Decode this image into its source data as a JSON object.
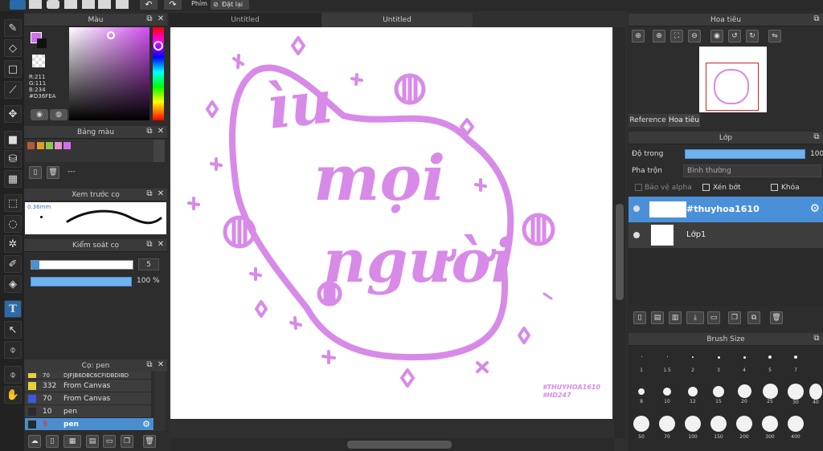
{
  "top_toolbar": {
    "items": [
      "Phím",
      "Đặt lại"
    ]
  },
  "tabs": [
    {
      "label": "Untitled"
    },
    {
      "label": "Untitled"
    }
  ],
  "color_panel": {
    "title": "Màu",
    "r": "R:211",
    "g": "G:111",
    "b": "B:234",
    "hex": "#D36FEA",
    "accent": "#d36fea"
  },
  "palette_panel": {
    "title": "Bảng màu",
    "dash": "---",
    "swatches": [
      "#b35a3a",
      "#e39b2d",
      "#8bc94a",
      "#e58fd4",
      "#d36fea"
    ]
  },
  "brush_preview_panel": {
    "title": "Xem trước cọ",
    "size": "0.36mm"
  },
  "brush_control_panel": {
    "title": "Kiểm soát cọ",
    "size_value": "5",
    "opacity_value": "100 %"
  },
  "brush_list_panel": {
    "title": "Cọ: pen",
    "items": [
      {
        "num": "70",
        "name": "DJFJB6DBC6CFIDBDIBD",
        "color": "#e8d23a"
      },
      {
        "num": "332",
        "name": "From Canvas",
        "color": "#e8d23a"
      },
      {
        "num": "70",
        "name": "From Canvas",
        "color": "#3a5ad8"
      },
      {
        "num": "10",
        "name": "pen",
        "color": "#2a2a2a"
      },
      {
        "num": "5",
        "name": "pen",
        "color": "#2a2a2a"
      }
    ]
  },
  "artwork": {
    "line1": "ìu",
    "line2": "mọi",
    "line3": "người",
    "signature_1": "#THUYHOA1610",
    "signature_2": "#HD247",
    "color": "#d88ae8"
  },
  "navigator_panel": {
    "title": "Hoa tiêu",
    "tab_reference": "Reference",
    "tab_navigator": "Hoa tiêu"
  },
  "layer_panel": {
    "title": "Lớp",
    "opacity_label": "Độ trong",
    "opacity_value": "100",
    "blend_label": "Pha trộn",
    "blend_value": "Bình thường",
    "protect_alpha": "Bảo vệ alpha",
    "clipping": "Xén bớt",
    "lock": "Khóa",
    "layers": [
      {
        "name": "#thuyhoa1610",
        "selected": true
      },
      {
        "name": "Lớp1",
        "selected": false
      }
    ]
  },
  "brush_size_panel": {
    "title": "Brush Size",
    "sizes": [
      "1",
      "1.5",
      "2",
      "3",
      "4",
      "5",
      "7",
      "8",
      "10",
      "12",
      "15",
      "20",
      "25",
      "30",
      "40",
      "50",
      "70",
      "100",
      "150",
      "200",
      "300",
      "400"
    ]
  }
}
